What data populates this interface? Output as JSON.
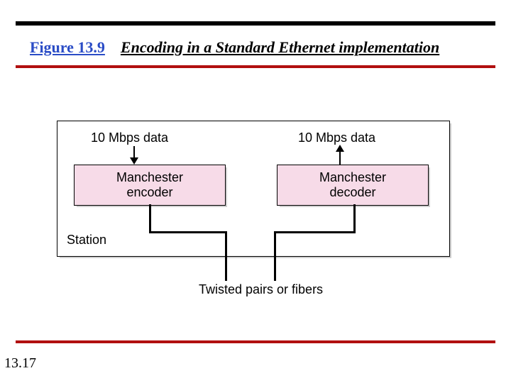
{
  "heading": {
    "figure": "Figure 13.9",
    "title": "Encoding in a Standard Ethernet implementation"
  },
  "diagram": {
    "data_left": "10 Mbps data",
    "data_right": "10 Mbps data",
    "encoder": "Manchester\nencoder",
    "decoder": "Manchester\ndecoder",
    "station_label": "Station",
    "medium_label": "Twisted pairs or fibers"
  },
  "page_number": "13.17"
}
